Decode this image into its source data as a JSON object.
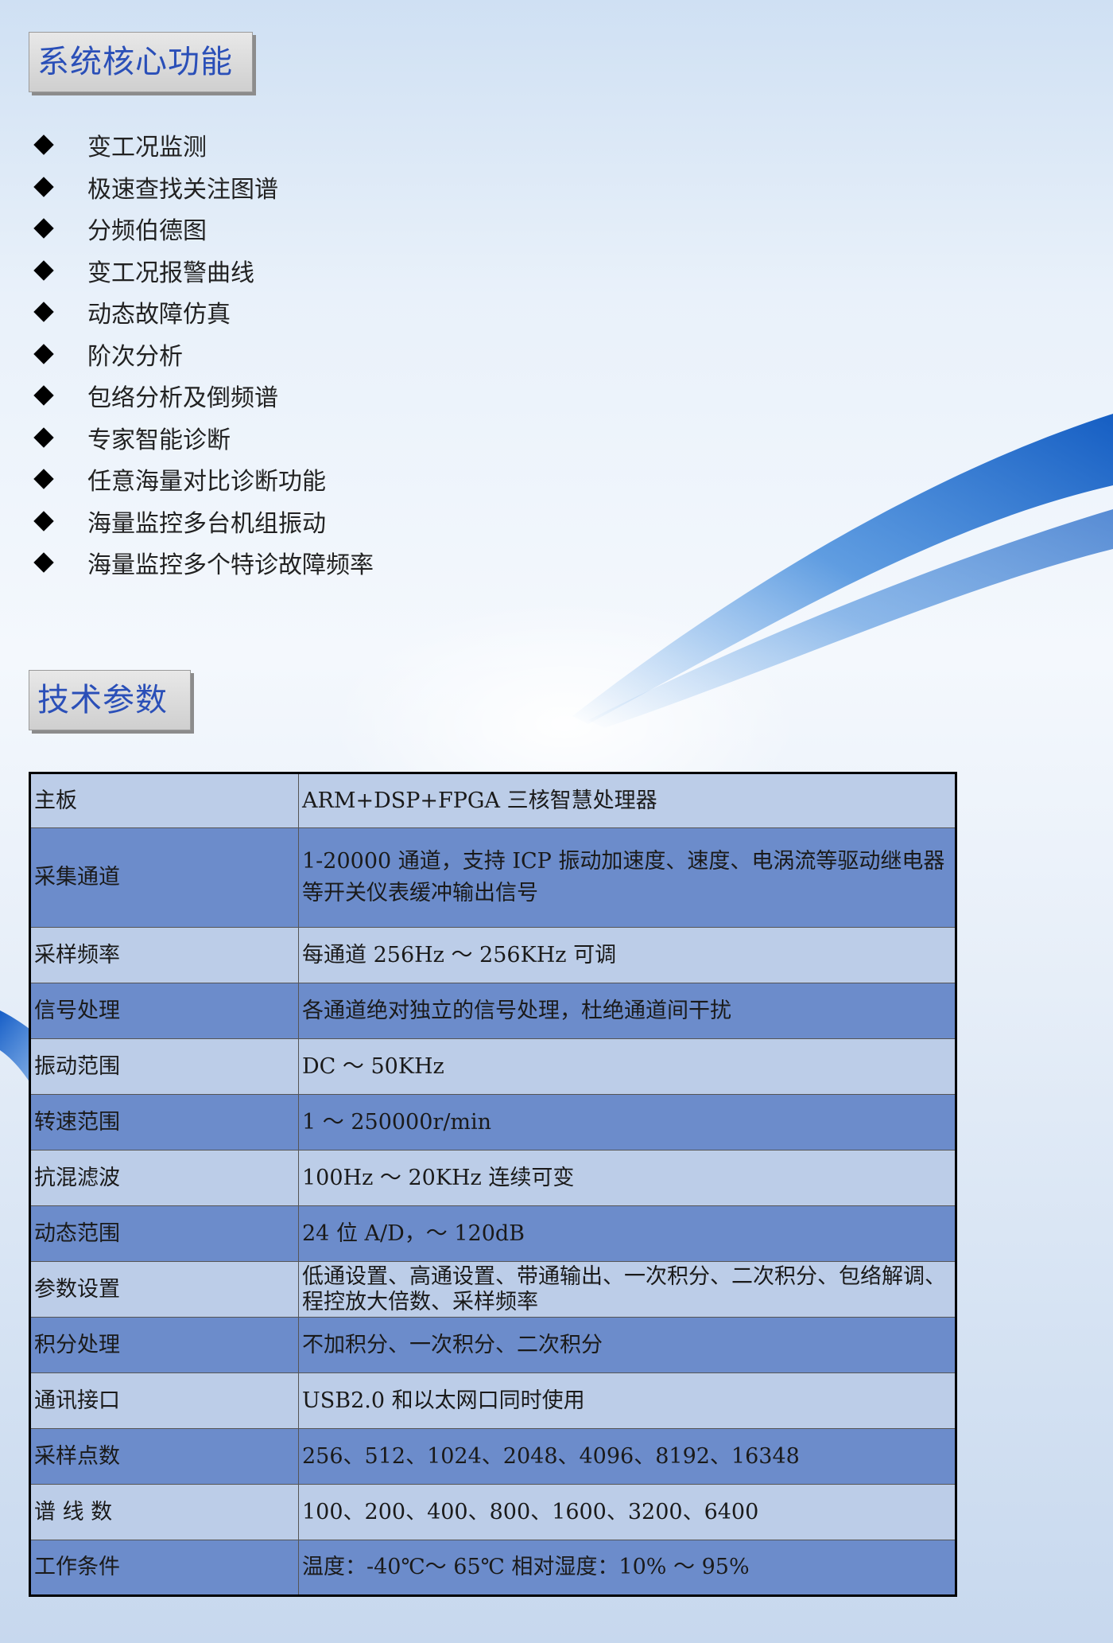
{
  "section1": {
    "title": "系统核心功能",
    "items": [
      "变工况监测",
      "极速查找关注图谱",
      "分频伯德图",
      "变工况报警曲线",
      "动态故障仿真",
      "阶次分析",
      "包络分析及倒频谱",
      "专家智能诊断",
      "任意海量对比诊断功能",
      "海量监控多台机组振动",
      "海量监控多个特诊故障频率"
    ]
  },
  "section2": {
    "title": "技术参数",
    "rows": [
      {
        "label": "主板",
        "value": "ARM+DSP+FPGA 三核智慧处理器"
      },
      {
        "label": "采集通道",
        "value": "1-20000 通道，支持 ICP 振动加速度、速度、电涡流等驱动继电器等开关仪表缓冲输出信号"
      },
      {
        "label": "采样频率",
        "value": "每通道 256Hz ～ 256KHz 可调"
      },
      {
        "label": "信号处理",
        "value": "各通道绝对独立的信号处理，杜绝通道间干扰"
      },
      {
        "label": "振动范围",
        "value": "DC ～ 50KHz"
      },
      {
        "label": "转速范围",
        "value": "1 ～ 250000r/min"
      },
      {
        "label": "抗混滤波",
        "value": "100Hz ～ 20KHz 连续可变"
      },
      {
        "label": "动态范围",
        "value": "24 位 A/D，～ 120dB"
      },
      {
        "label": "参数设置",
        "value": "低通设置、高通设置、带通输出、一次积分、二次积分、包络解调、程控放大倍数、采样频率"
      },
      {
        "label": "积分处理",
        "value": "不加积分、一次积分、二次积分"
      },
      {
        "label": "通讯接口",
        "value": "USB2.0 和以太网口同时使用"
      },
      {
        "label": "采样点数",
        "value": "256、512、1024、2048、4096、8192、16348"
      },
      {
        "label": "谱 线 数",
        "value": "100、200、400、800、1600、3200、6400"
      },
      {
        "label": "工作条件",
        "value": "温度：-40℃～ 65℃ 相对湿度：10% ～ 95%"
      }
    ]
  }
}
